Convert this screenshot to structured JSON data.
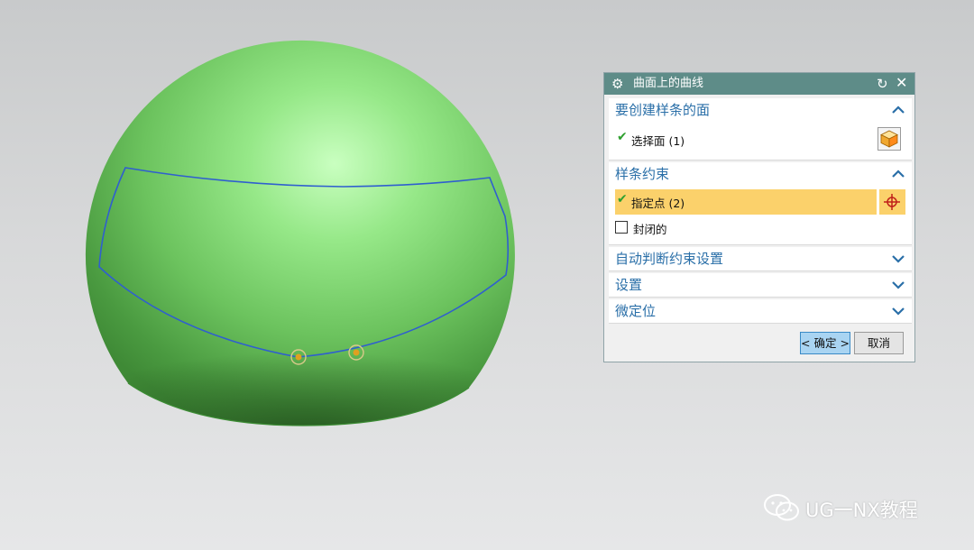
{
  "dialog": {
    "title": "曲面上的曲线",
    "groups": {
      "face": {
        "label": "要创建样条的面",
        "select_face": "选择面 (1)"
      },
      "spline_constraints": {
        "label": "样条约束",
        "specify_point": "指定点 (2)",
        "closed": "封闭的",
        "closed_checked": false
      },
      "auto_constraints": {
        "label": "自动判断约束设置"
      },
      "settings": {
        "label": "设置"
      },
      "fine_position": {
        "label": "微定位"
      }
    },
    "buttons": {
      "ok": "< 确定 >",
      "cancel": "取消"
    }
  },
  "watermark": {
    "text": "UG一NX教程"
  },
  "colors": {
    "title_bar": "#5e8c88",
    "group_label": "#2a6fa8",
    "highlight_row": "#fbd16b",
    "ok_button": "#a9d4f2",
    "sphere": "#7fd870",
    "curve": "#2f5fcf"
  }
}
